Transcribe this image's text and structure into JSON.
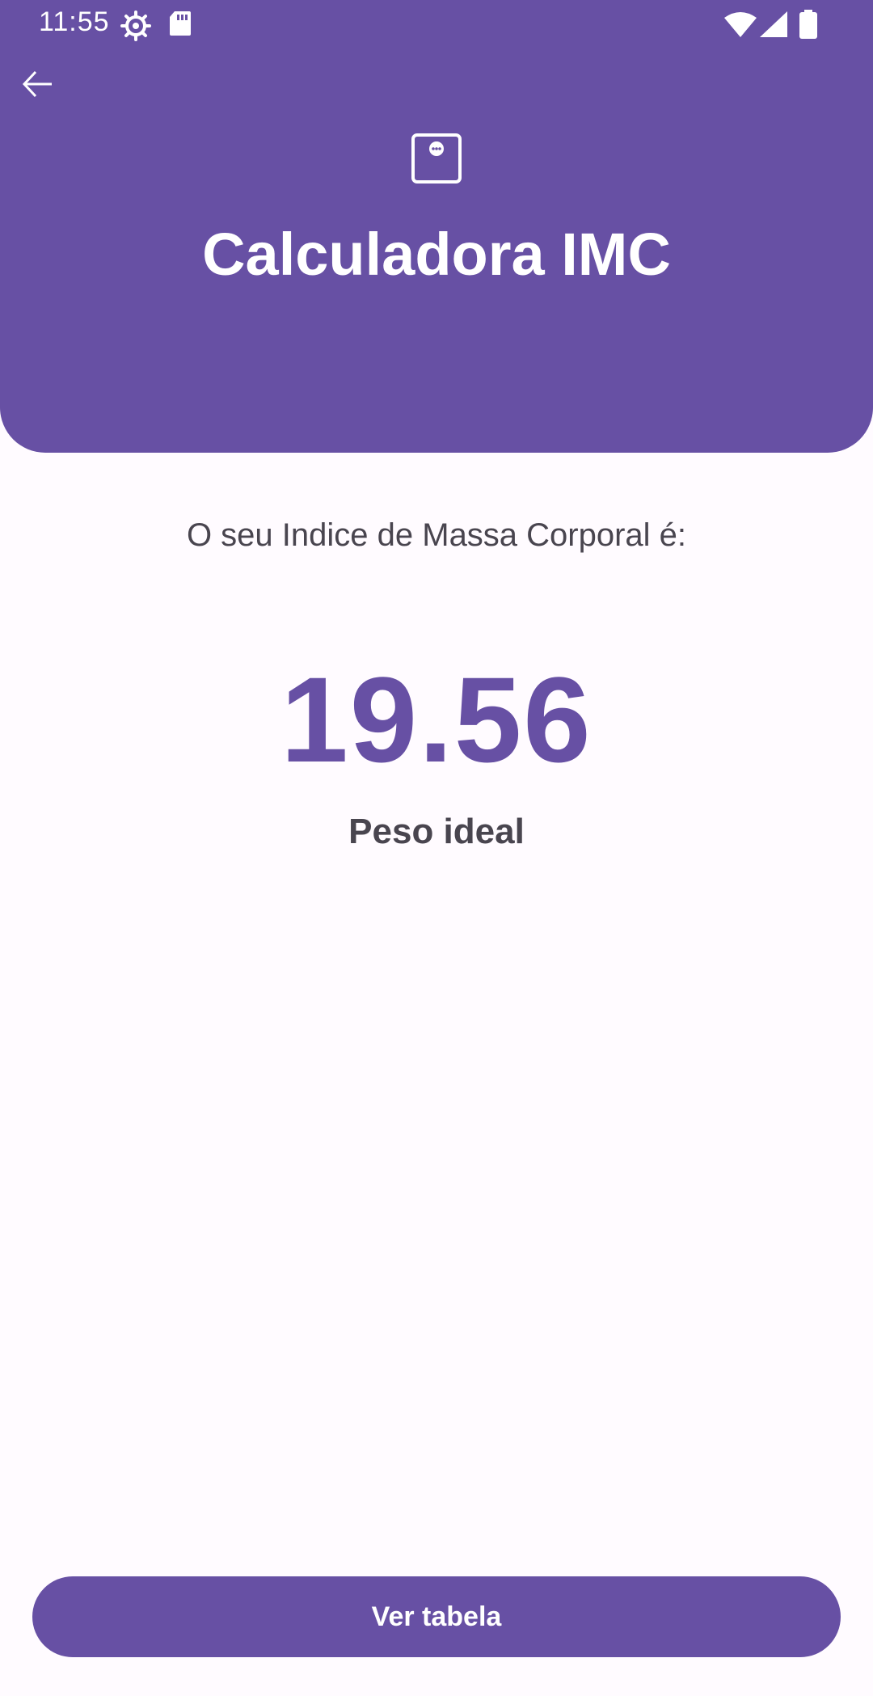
{
  "status_bar": {
    "time": "11:55",
    "icons": [
      "settings-gear-icon",
      "sd-card-icon",
      "wifi-icon",
      "cellular-signal-icon",
      "battery-icon"
    ]
  },
  "header": {
    "back_icon": "arrow-back-icon",
    "app_icon": "scale-icon",
    "title": "Calculadora IMC"
  },
  "result": {
    "label": "O seu Indice de Massa Corporal é:",
    "value": "19.56",
    "category": "Peso ideal"
  },
  "actions": {
    "table_button_label": "Ver tabela"
  },
  "colors": {
    "primary": "#6750a4",
    "background": "#fffbff",
    "text_secondary": "#49454f",
    "on_primary": "#ffffff"
  }
}
